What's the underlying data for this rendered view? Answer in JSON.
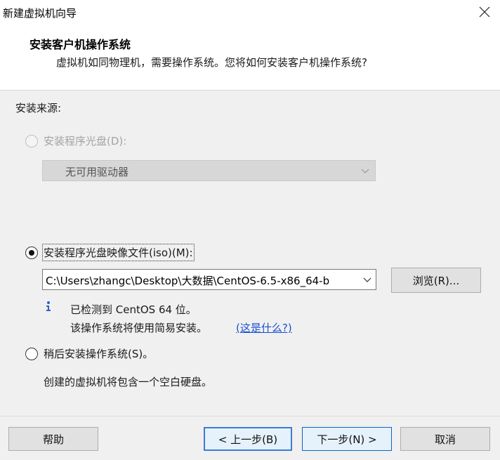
{
  "window": {
    "title": "新建虚拟机向导",
    "close_icon": "close-icon"
  },
  "header": {
    "title": "安装客户机操作系统",
    "subtitle": "虚拟机如同物理机，需要操作系统。您将如何安装客户机操作系统?"
  },
  "install_source": {
    "label": "安装来源:",
    "options": [
      {
        "label": "安装程序光盘(D):",
        "selected": false,
        "enabled": false
      },
      {
        "label": "安装程序光盘映像文件(iso)(M):",
        "selected": true,
        "enabled": true
      },
      {
        "label": "稍后安装操作系统(S)。",
        "selected": false,
        "enabled": true
      }
    ],
    "disc_drive": {
      "value": "无可用驱动器",
      "enabled": false
    },
    "iso_path": {
      "value": "C:\\Users\\zhangc\\Desktop\\大数据\\CentOS-6.5-x86_64-b"
    },
    "browse_label": "浏览(R)...",
    "detected_line": "已检测到 CentOS 64 位。",
    "easy_install_line": "该操作系统将使用简易安装。",
    "whats_this_link": "(这是什么?)",
    "later_desc": "创建的虚拟机将包含一个空白硬盘。",
    "info_icon": "info-icon"
  },
  "footer": {
    "help": "帮助",
    "back": "< 上一步(B)",
    "next": "下一步(N) >",
    "cancel": "取消"
  },
  "colors": {
    "accent": "#3d7bd6",
    "link": "#1b4fd1",
    "panel": "#f0f0f0"
  }
}
